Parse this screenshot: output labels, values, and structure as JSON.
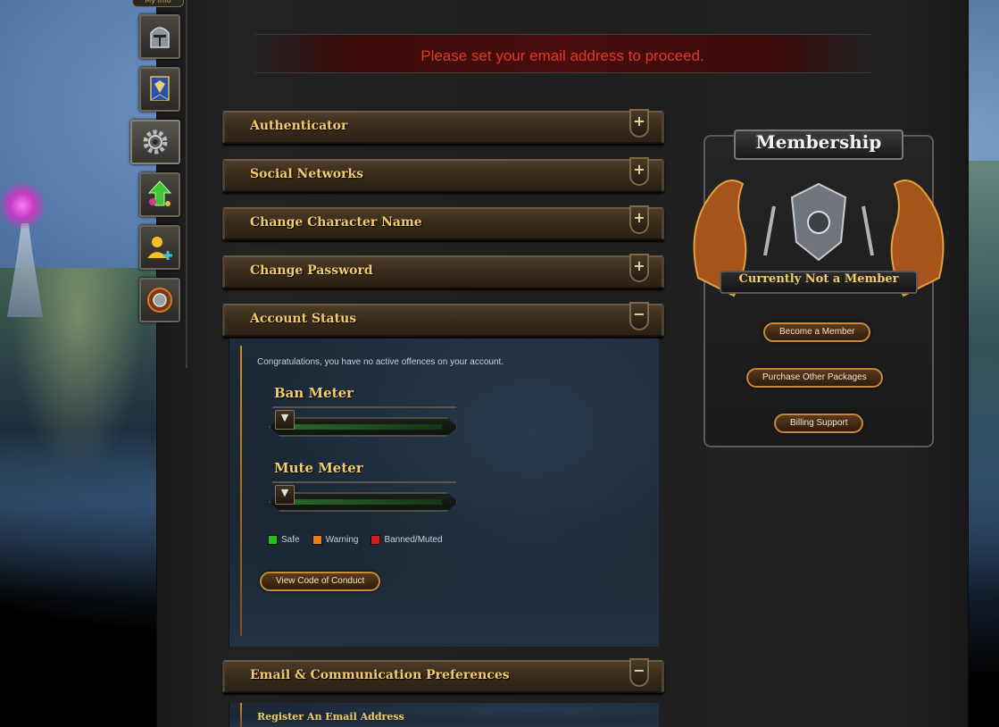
{
  "notice": {
    "text": "Please set your email address to proceed.",
    "color": "#e23a28"
  },
  "nav": {
    "top_tab_label": "My Info",
    "items": [
      {
        "name": "helmet-icon"
      },
      {
        "name": "banner-icon"
      },
      {
        "name": "gear-icon"
      },
      {
        "name": "upgrade-arrow-icon"
      },
      {
        "name": "add-friend-icon"
      },
      {
        "name": "shield-orb-icon"
      }
    ]
  },
  "sections": {
    "authenticator": {
      "title": "Authenticator",
      "toggle": "+"
    },
    "social": {
      "title": "Social Networks",
      "toggle": "+"
    },
    "character": {
      "title": "Change Character Name",
      "toggle": "+"
    },
    "password": {
      "title": "Change Password",
      "toggle": "+"
    },
    "account_status": {
      "title": "Account Status",
      "toggle": "−"
    },
    "email": {
      "title": "Email & Communication Preferences",
      "toggle": "−"
    }
  },
  "account_status": {
    "message": "Congratulations, you have no active offences on your account.",
    "ban_meter": {
      "title": "Ban Meter",
      "level": 0
    },
    "mute_meter": {
      "title": "Mute Meter",
      "level": 0
    },
    "legend": [
      {
        "label": "Safe",
        "color": "#22c122"
      },
      {
        "label": "Warning",
        "color": "#e0821a"
      },
      {
        "label": "Banned/Muted",
        "color": "#d41c1c"
      }
    ],
    "code_of_conduct_button": "View Code of Conduct"
  },
  "email_prefs": {
    "subtitle": "Register An Email Address"
  },
  "membership": {
    "title": "Membership",
    "status": "Currently Not a Member",
    "buttons": {
      "become": "Become a Member",
      "packages": "Purchase Other Packages",
      "billing": "Billing Support"
    }
  },
  "colors": {
    "accent_gold": "#f2cc6b",
    "panel_bg": "#1e1e1e",
    "button_border": "#c68a3a"
  }
}
